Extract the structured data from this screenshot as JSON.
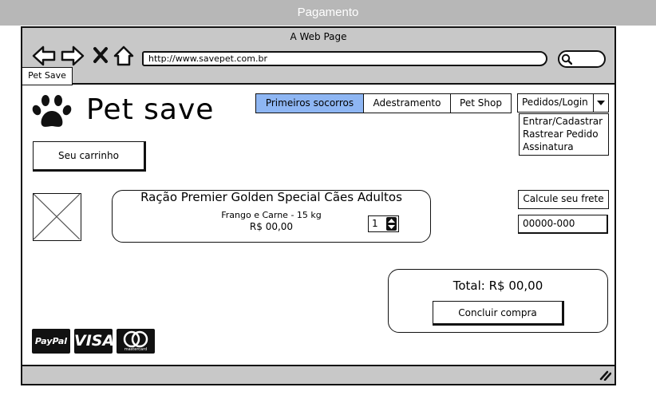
{
  "titlebar": {
    "title": "Pagamento"
  },
  "browser": {
    "page_title": "A Web Page",
    "url": "http://www.savepet.com.br",
    "tab_label": "Pet Save"
  },
  "header": {
    "brand": "Pet save",
    "cart_button": "Seu carrinho",
    "menu": [
      "Primeiros socorros",
      "Adestramento",
      "Pet Shop"
    ],
    "active_menu": "Primeiros socorros",
    "account_dropdown": {
      "selected": "Pedidos/Login",
      "options": [
        "Entrar/Cadastrar",
        "Rastrear Pedido",
        "Assinatura"
      ]
    }
  },
  "product": {
    "title": "Ração Premier Golden Special Cães Adultos",
    "subtitle": "Frango e Carne - 15 kg",
    "price": "R$ 00,00",
    "quantity": "1"
  },
  "shipping": {
    "button": "Calcule seu frete",
    "cep_value": "00000-000"
  },
  "checkout": {
    "total": "Total: R$ 00,00",
    "button": "Concluir compra"
  },
  "payment_logos": {
    "paypal": "PayPal",
    "visa": "VISA",
    "mastercard": "mastercard"
  },
  "colors": {
    "active_menu_bg": "#8eb6f3",
    "chrome_gray": "#c8c8c8",
    "titlebar_gray": "#b7b7b7"
  }
}
